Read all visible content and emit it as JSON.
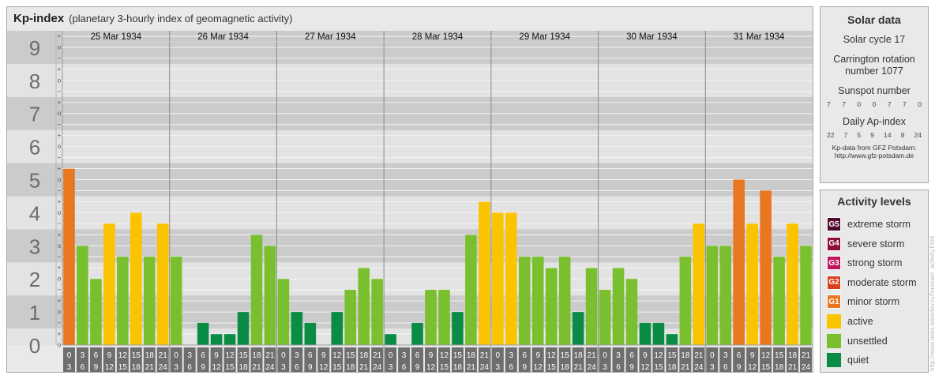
{
  "title": "Kp-index",
  "subtitle": "(planetary 3-hourly index of geomagnetic activity)",
  "chart_data": {
    "type": "bar",
    "title": "Kp-index",
    "subtitle": "(planetary 3-hourly index of geomagnetic activity)",
    "ylim": [
      0,
      9
    ],
    "y_ticks": [
      "0",
      "1",
      "2",
      "3",
      "4",
      "5",
      "6",
      "7",
      "8",
      "9"
    ],
    "minor_tick_labels": [
      "o",
      "+",
      "−"
    ],
    "days": [
      "25 Mar 1934",
      "26 Mar 1934",
      "27 Mar 1934",
      "28 Mar 1934",
      "29 Mar 1934",
      "30 Mar 1934",
      "31 Mar 1934"
    ],
    "interval_labels": [
      [
        "0",
        "3"
      ],
      [
        "3",
        "6"
      ],
      [
        "6",
        "9"
      ],
      [
        "9",
        "12"
      ],
      [
        "12",
        "15"
      ],
      [
        "15",
        "18"
      ],
      [
        "18",
        "21"
      ],
      [
        "21",
        "24"
      ]
    ],
    "values": [
      [
        5.33,
        3.0,
        2.0,
        3.67,
        2.67,
        4.0,
        2.67,
        3.67
      ],
      [
        2.67,
        0.0,
        0.67,
        0.33,
        0.33,
        1.0,
        3.33,
        3.0
      ],
      [
        2.0,
        1.0,
        0.67,
        0.0,
        1.0,
        1.67,
        2.33,
        2.0
      ],
      [
        0.33,
        0.0,
        0.67,
        1.67,
        1.67,
        1.0,
        3.33,
        4.33
      ],
      [
        4.0,
        4.0,
        2.67,
        2.67,
        2.33,
        2.67,
        1.0,
        2.33
      ],
      [
        1.67,
        2.33,
        2.0,
        0.67,
        0.67,
        0.33,
        2.67,
        3.67
      ],
      [
        3.0,
        3.0,
        5.0,
        3.67,
        4.67,
        2.67,
        3.67,
        3.0
      ]
    ]
  },
  "colors": {
    "quiet": "#0a8c45",
    "unsettled": "#7ac02e",
    "active": "#fbc400",
    "minor": "#e8771f",
    "moderate": "#d9401c",
    "strong": "#c0145c",
    "severe": "#8c0a3c",
    "extreme": "#500a2c"
  },
  "solar": {
    "header": "Solar data",
    "cycle": "Solar cycle 17",
    "carrington": "Carrington rotation number 1077",
    "sunspot_label": "Sunspot number",
    "sunspot_values": [
      "7",
      "7",
      "0",
      "0",
      "7",
      "7",
      "0"
    ],
    "ap_label": "Daily Ap-index",
    "ap_values": [
      "22",
      "7",
      "5",
      "9",
      "14",
      "8",
      "24"
    ],
    "credit_line1": "Kp-data from GFZ Potsdam:",
    "credit_line2": "http://www.gfz-potsdam.de"
  },
  "activity": {
    "header": "Activity levels",
    "levels": [
      {
        "badge": "G5",
        "label": "extreme storm",
        "color": "#500a2c"
      },
      {
        "badge": "G4",
        "label": "severe storm",
        "color": "#8c0a3c"
      },
      {
        "badge": "G3",
        "label": "strong storm",
        "color": "#c0145c"
      },
      {
        "badge": "G2",
        "label": "moderate storm",
        "color": "#d9401c"
      },
      {
        "badge": "G1",
        "label": "minor storm",
        "color": "#e8771f"
      },
      {
        "badge": "",
        "label": "active",
        "color": "#fbc400"
      },
      {
        "badge": "",
        "label": "unsettled",
        "color": "#7ac02e"
      },
      {
        "badge": "",
        "label": "quiet",
        "color": "#0a8c45"
      }
    ]
  },
  "watermark": "http://www.tesis.lebedev.ru/forecast_activity.html"
}
